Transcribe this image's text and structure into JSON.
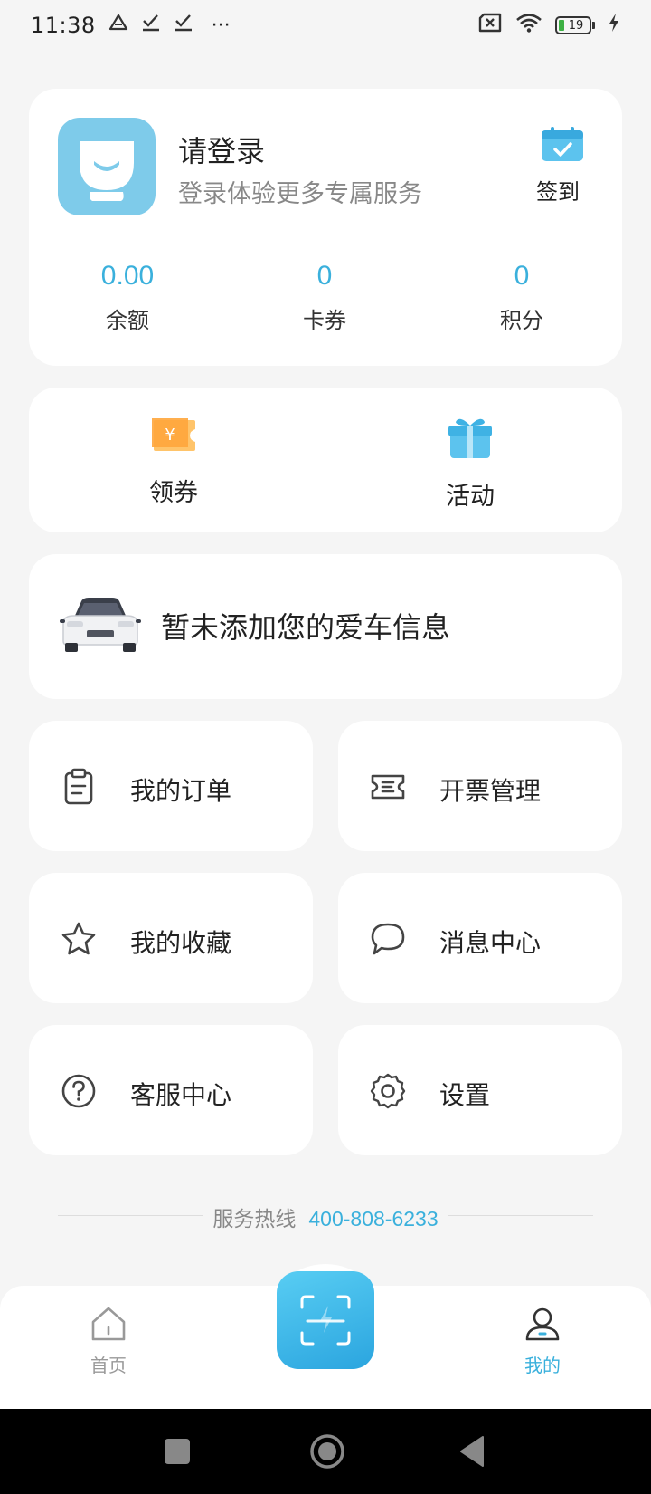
{
  "status_bar": {
    "time": "11:38",
    "notif_more": "···",
    "battery_level": "19",
    "icons": [
      "drive-icon",
      "check-icon",
      "check-icon",
      "sim-x-icon",
      "wifi-icon",
      "battery-icon",
      "charging-icon"
    ]
  },
  "profile": {
    "title": "请登录",
    "subtitle": "登录体验更多专属服务",
    "checkin_label": "签到",
    "stats": [
      {
        "value": "0.00",
        "label": "余额"
      },
      {
        "value": "0",
        "label": "卡券"
      },
      {
        "value": "0",
        "label": "积分"
      }
    ]
  },
  "quick_actions": [
    {
      "label": "领券",
      "icon": "coupon-icon"
    },
    {
      "label": "活动",
      "icon": "gift-icon"
    }
  ],
  "car": {
    "text": "暂未添加您的爱车信息"
  },
  "menu": [
    {
      "label": "我的订单",
      "icon": "clipboard-icon"
    },
    {
      "label": "开票管理",
      "icon": "ticket-icon"
    },
    {
      "label": "我的收藏",
      "icon": "star-icon"
    },
    {
      "label": "消息中心",
      "icon": "chat-bubble-icon"
    },
    {
      "label": "客服中心",
      "icon": "help-icon"
    },
    {
      "label": "设置",
      "icon": "gear-icon"
    }
  ],
  "hotline": {
    "label": "服务热线",
    "number": "400-808-6233"
  },
  "tabbar": {
    "home_label": "首页",
    "mine_label": "我的",
    "active": "我的"
  },
  "colors": {
    "accent": "#3ab0dc",
    "background": "#f5f5f5",
    "coupon_orange": "#ffa63c"
  }
}
